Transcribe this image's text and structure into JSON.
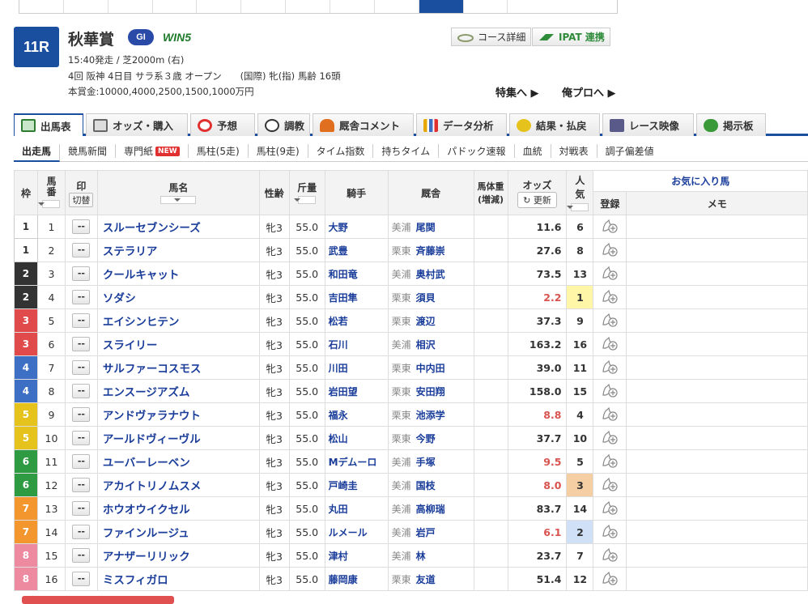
{
  "race": {
    "number": "11R",
    "name": "秋華賞",
    "grade": "GI",
    "win5": "WIN5",
    "line1": "15:40発走 / 芝2000m (右)",
    "line2": "4回 阪神 4日目 サラ系３歳 オープン　　(国際) 牝(指) 馬齢 16頭",
    "line3": "本賞金:10000,4000,2500,1500,1000万円",
    "course_btn": "コース詳細",
    "ipat_btn": "IPAT 連携",
    "feature_link": "特集へ ▶",
    "pro_link": "俺プロへ ▶"
  },
  "tabs": [
    {
      "label": "出馬表",
      "icon": "table-icon",
      "color": "#2e7d32"
    },
    {
      "label": "オッズ・購入",
      "icon": "odds-icon",
      "color": "#666"
    },
    {
      "label": "予想",
      "icon": "target-icon",
      "color": "#e03030"
    },
    {
      "label": "調教",
      "icon": "stopwatch-icon",
      "color": "#333"
    },
    {
      "label": "厩舎コメント",
      "icon": "stable-icon",
      "color": "#e07020"
    },
    {
      "label": "データ分析",
      "icon": "bar-chart-icon",
      "color": "#e6a800"
    },
    {
      "label": "結果・払戻",
      "icon": "coins-icon",
      "color": "#d4a017"
    },
    {
      "label": "レース映像",
      "icon": "video-icon",
      "color": "#5a5a8a"
    },
    {
      "label": "掲示板",
      "icon": "chat-icon",
      "color": "#3a9a3a"
    }
  ],
  "subnav": [
    "出走馬",
    "競馬新聞",
    "専門紙",
    "馬柱(5走)",
    "馬柱(9走)",
    "タイム指数",
    "持ちタイム",
    "パドック速報",
    "血統",
    "対戦表",
    "調子偏差値"
  ],
  "new_badge": "NEW",
  "table": {
    "headers": {
      "waku": "枠",
      "umaban": "馬番",
      "mark": "印",
      "kirikae": "切替",
      "name": "馬名",
      "sexage": "性齢",
      "weight": "斤量",
      "jockey": "騎手",
      "stable": "厩舎",
      "bodyweight": "馬体重",
      "bodyweight_sub": "(増減)",
      "odds": "オッズ",
      "refresh": "更新",
      "popularity": "人気",
      "favorite": "お気に入り馬",
      "register": "登録",
      "memo": "メモ"
    },
    "mark_placeholder": "--",
    "rows": [
      {
        "waku": "1",
        "umaban": "1",
        "name": "スルーセブンシーズ",
        "sexage": "牝3",
        "weight": "55.0",
        "jockey": "大野",
        "area": "美浦",
        "trainer": "尾関",
        "odds": "11.6",
        "pop": "6"
      },
      {
        "waku": "1",
        "umaban": "2",
        "name": "ステラリア",
        "sexage": "牝3",
        "weight": "55.0",
        "jockey": "武豊",
        "area": "栗東",
        "trainer": "斉藤崇",
        "odds": "27.6",
        "pop": "8"
      },
      {
        "waku": "2",
        "umaban": "3",
        "name": "クールキャット",
        "sexage": "牝3",
        "weight": "55.0",
        "jockey": "和田竜",
        "area": "美浦",
        "trainer": "奥村武",
        "odds": "73.5",
        "pop": "13"
      },
      {
        "waku": "2",
        "umaban": "4",
        "name": "ソダシ",
        "sexage": "牝3",
        "weight": "55.0",
        "jockey": "吉田隼",
        "area": "栗東",
        "trainer": "須貝",
        "odds": "2.2",
        "pop": "1"
      },
      {
        "waku": "3",
        "umaban": "5",
        "name": "エイシンヒテン",
        "sexage": "牝3",
        "weight": "55.0",
        "jockey": "松若",
        "area": "栗東",
        "trainer": "渡辺",
        "odds": "37.3",
        "pop": "9"
      },
      {
        "waku": "3",
        "umaban": "6",
        "name": "スライリー",
        "sexage": "牝3",
        "weight": "55.0",
        "jockey": "石川",
        "area": "美浦",
        "trainer": "相沢",
        "odds": "163.2",
        "pop": "16"
      },
      {
        "waku": "4",
        "umaban": "7",
        "name": "サルファーコスモス",
        "sexage": "牝3",
        "weight": "55.0",
        "jockey": "川田",
        "area": "栗東",
        "trainer": "中内田",
        "odds": "39.0",
        "pop": "11"
      },
      {
        "waku": "4",
        "umaban": "8",
        "name": "エンスージアズム",
        "sexage": "牝3",
        "weight": "55.0",
        "jockey": "岩田望",
        "area": "栗東",
        "trainer": "安田翔",
        "odds": "158.0",
        "pop": "15"
      },
      {
        "waku": "5",
        "umaban": "9",
        "name": "アンドヴァラナウト",
        "sexage": "牝3",
        "weight": "55.0",
        "jockey": "福永",
        "area": "栗東",
        "trainer": "池添学",
        "odds": "8.8",
        "pop": "4"
      },
      {
        "waku": "5",
        "umaban": "10",
        "name": "アールドヴィーヴル",
        "sexage": "牝3",
        "weight": "55.0",
        "jockey": "松山",
        "area": "栗東",
        "trainer": "今野",
        "odds": "37.7",
        "pop": "10"
      },
      {
        "waku": "6",
        "umaban": "11",
        "name": "ユーバーレーベン",
        "sexage": "牝3",
        "weight": "55.0",
        "jockey": "Mデムーロ",
        "area": "美浦",
        "trainer": "手塚",
        "odds": "9.5",
        "pop": "5"
      },
      {
        "waku": "6",
        "umaban": "12",
        "name": "アカイトリノムスメ",
        "sexage": "牝3",
        "weight": "55.0",
        "jockey": "戸崎圭",
        "area": "美浦",
        "trainer": "国枝",
        "odds": "8.0",
        "pop": "3"
      },
      {
        "waku": "7",
        "umaban": "13",
        "name": "ホウオウイクセル",
        "sexage": "牝3",
        "weight": "55.0",
        "jockey": "丸田",
        "area": "美浦",
        "trainer": "高柳瑞",
        "odds": "83.7",
        "pop": "14"
      },
      {
        "waku": "7",
        "umaban": "14",
        "name": "ファインルージュ",
        "sexage": "牝3",
        "weight": "55.0",
        "jockey": "ルメール",
        "area": "美浦",
        "trainer": "岩戸",
        "odds": "6.1",
        "pop": "2"
      },
      {
        "waku": "8",
        "umaban": "15",
        "name": "アナザーリリック",
        "sexage": "牝3",
        "weight": "55.0",
        "jockey": "津村",
        "area": "美浦",
        "trainer": "林",
        "odds": "23.7",
        "pop": "7"
      },
      {
        "waku": "8",
        "umaban": "16",
        "name": "ミスフィガロ",
        "sexage": "牝3",
        "weight": "55.0",
        "jockey": "藤岡康",
        "area": "栗東",
        "trainer": "友道",
        "odds": "51.4",
        "pop": "12"
      }
    ]
  }
}
